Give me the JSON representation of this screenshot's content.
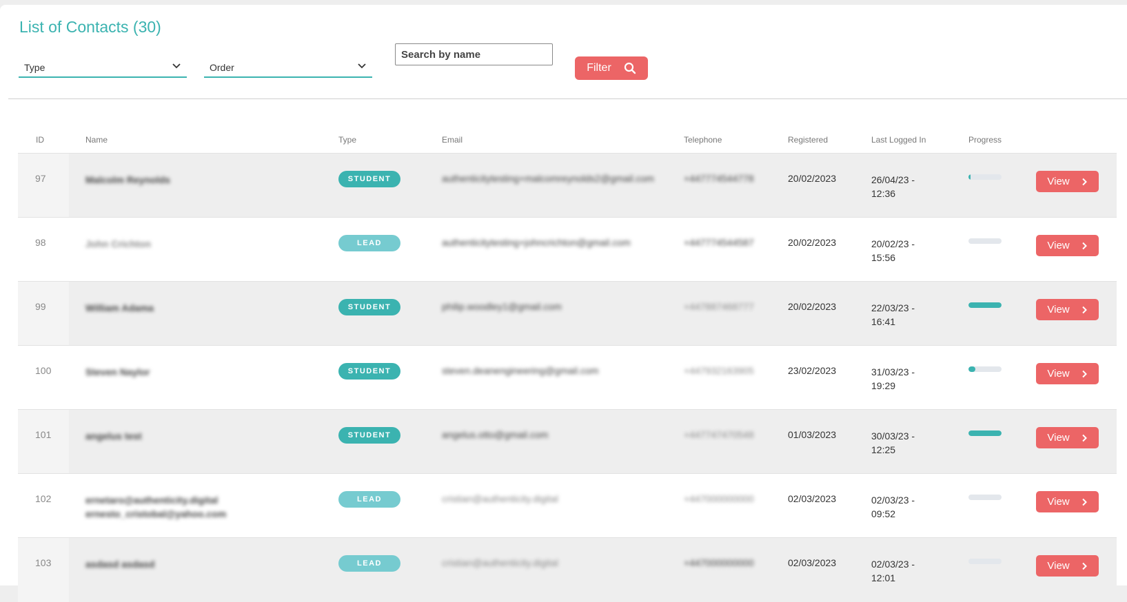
{
  "header": {
    "title": "List of Contacts (30)",
    "type_select": "Type",
    "order_select": "Order",
    "search_placeholder": "Search by name",
    "filter_label": "Filter"
  },
  "colors": {
    "accent": "#3bb3b0",
    "lead": "#76cbd0",
    "button": "#ec6566"
  },
  "table": {
    "columns": [
      "ID",
      "Name",
      "Type",
      "Email",
      "Telephone",
      "Registered",
      "Last Logged In",
      "Progress"
    ],
    "view_label": "View",
    "rows": [
      {
        "id": "97",
        "name": "Malcolm Reynolds",
        "name2": "",
        "type": "STUDENT",
        "email": "authenticitytesting+malcomreynolds2@gmail.com",
        "phone": "+447774544778",
        "registered": "20/02/2023",
        "last1": "26/04/23 -",
        "last2": "12:36",
        "progress": 0.04
      },
      {
        "id": "98",
        "name": "John Crichton",
        "name2": "",
        "type": "LEAD",
        "email": "authenticitytesting+johncrichton@gmail.com",
        "phone": "+447774544587",
        "registered": "20/02/2023",
        "last1": "20/02/23 -",
        "last2": "15:56",
        "progress": 0
      },
      {
        "id": "99",
        "name": "William Adama",
        "name2": "",
        "type": "STUDENT",
        "email": "philip.woodley1@gmail.com",
        "phone": "+447887468777",
        "registered": "20/02/2023",
        "last1": "22/03/23 -",
        "last2": "16:41",
        "progress": 1
      },
      {
        "id": "100",
        "name": "Steven Naylor",
        "name2": "",
        "type": "STUDENT",
        "email": "steven.deanengineering@gmail.com",
        "phone": "+447932163905",
        "registered": "23/02/2023",
        "last1": "31/03/23 -",
        "last2": "19:29",
        "progress": 0.2
      },
      {
        "id": "101",
        "name": "angelus test",
        "name2": "",
        "type": "STUDENT",
        "email": "angelus.otto@gmail.com",
        "phone": "+447747470548",
        "registered": "01/03/2023",
        "last1": "30/03/23 -",
        "last2": "12:25",
        "progress": 1
      },
      {
        "id": "102",
        "name": "ernetaro@authenticity.digital",
        "name2": "ernesto_cristobal@yahoo.com",
        "type": "LEAD",
        "email": "cristian@authenticity.digital",
        "phone": "+447000000000",
        "registered": "02/03/2023",
        "last1": "02/03/23 -",
        "last2": "09:52",
        "progress": 0
      },
      {
        "id": "103",
        "name": "asdasd asdasd",
        "name2": "",
        "type": "LEAD",
        "email": "cristian@authenticity.digital",
        "phone": "+447000000000",
        "registered": "02/03/2023",
        "last1": "02/03/23 -",
        "last2": "12:01",
        "progress": 0
      }
    ]
  }
}
